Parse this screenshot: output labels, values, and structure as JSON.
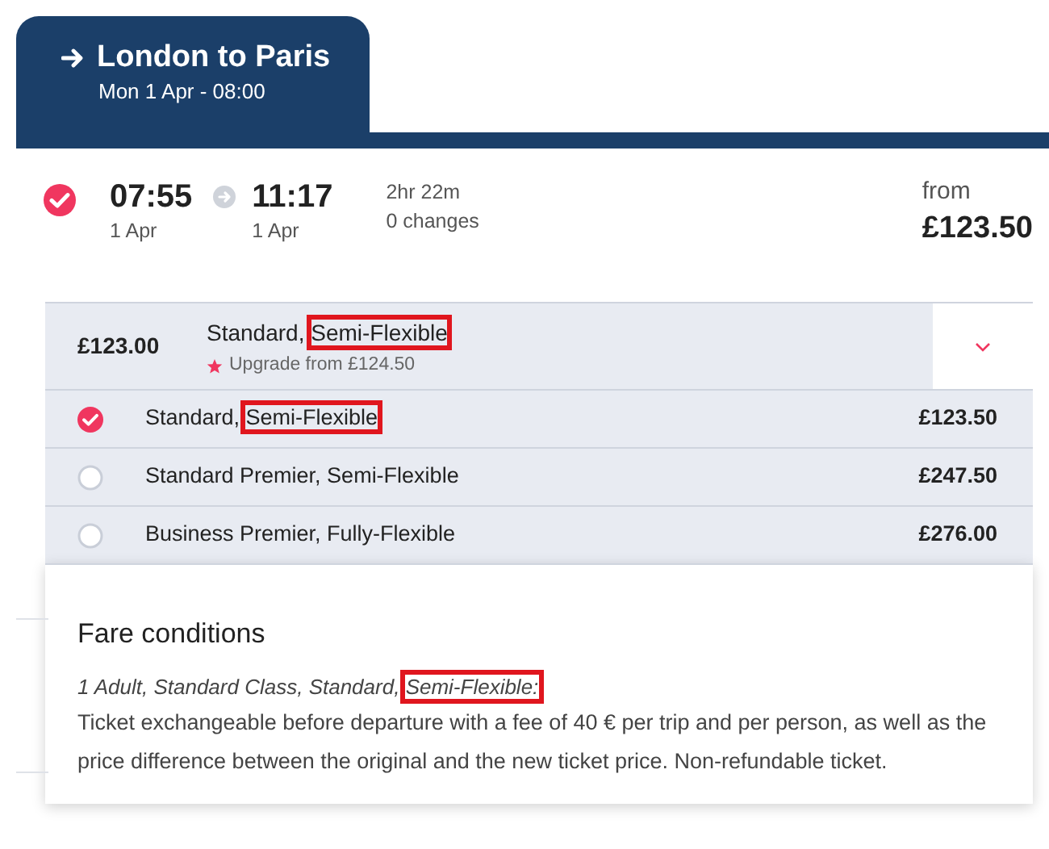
{
  "trip": {
    "title": "London to Paris",
    "subtitle": "Mon 1 Apr - 08:00"
  },
  "journey": {
    "selected": true,
    "depart_time": "07:55",
    "depart_date": "1 Apr",
    "arrive_time": "11:17",
    "arrive_date": "1 Apr",
    "duration": "2hr 22m",
    "changes": "0 changes",
    "price_prefix": "from",
    "price": "£123.50"
  },
  "fare_selector": {
    "price": "£123.00",
    "label": [
      {
        "text": "Standard, ",
        "highlighted": false
      },
      {
        "text": "Semi-Flexible",
        "highlighted": true
      }
    ],
    "upgrade": "Upgrade from £124.50",
    "expanded": true
  },
  "fare_options": [
    {
      "label": [
        {
          "text": "Standard, ",
          "highlighted": false
        },
        {
          "text": "Semi-Flexible",
          "highlighted": true
        }
      ],
      "price": "£123.50",
      "selected": true
    },
    {
      "label": [
        {
          "text": "Standard Premier, Semi-Flexible",
          "highlighted": false
        }
      ],
      "price": "£247.50",
      "selected": false
    },
    {
      "label": [
        {
          "text": "Business Premier, Fully-Flexible",
          "highlighted": false
        }
      ],
      "price": "£276.00",
      "selected": false
    }
  ],
  "fare_conditions": {
    "title": "Fare conditions",
    "summary": [
      {
        "text": "1 Adult, Standard Class, Standard, ",
        "highlighted": false
      },
      {
        "text": "Semi-Flexible:",
        "highlighted": true
      }
    ],
    "text": "Ticket exchangeable before departure with a fee of 40 € per trip and per person, as well as the price difference between the original and the new ticket price. Non-refundable ticket."
  }
}
